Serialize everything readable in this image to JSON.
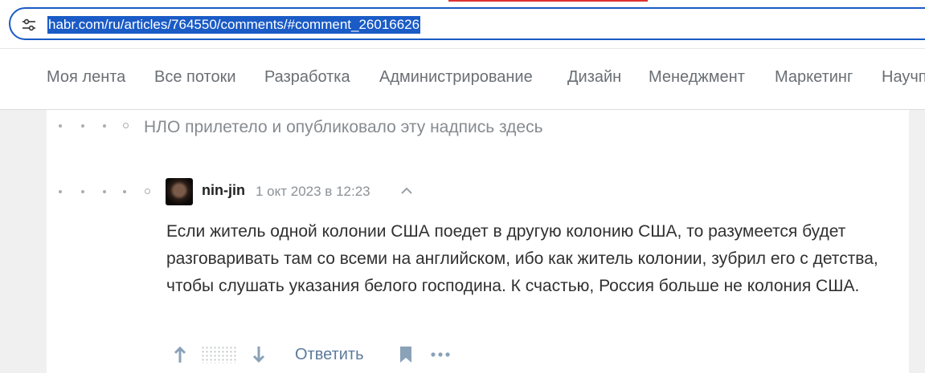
{
  "browser": {
    "url": "habr.com/ru/articles/764550/comments/#comment_26016626",
    "icons": {
      "site_settings": "tune-icon"
    }
  },
  "nav": {
    "items": [
      "Моя лента",
      "Все потоки",
      "Разработка",
      "Администрирование",
      "Дизайн",
      "Менеджмент",
      "Маркетинг",
      "Научп"
    ]
  },
  "thread": {
    "ufo_notice": "НЛО прилетело и опубликовало эту надпись здесь"
  },
  "comment": {
    "author": "nin-jin",
    "date": "1 окт 2023 в 12:23",
    "text": "Если житель одной колонии США поедет в другую колонию США, то разумеется будет разговаривать там со всеми на английском, ибо как житель колонии, зубрил его с детства, чтобы слушать указания белого господина. К счастью, Россия больше не колония США.",
    "reply_label": "Ответить",
    "icons": [
      "chevron-up-icon",
      "arrow-up-icon",
      "arrow-down-icon",
      "bookmark-icon",
      "more-icon"
    ]
  },
  "colors": {
    "accent": "#1a5bc6",
    "link": "#5b7a9a",
    "muted": "#868b90"
  }
}
